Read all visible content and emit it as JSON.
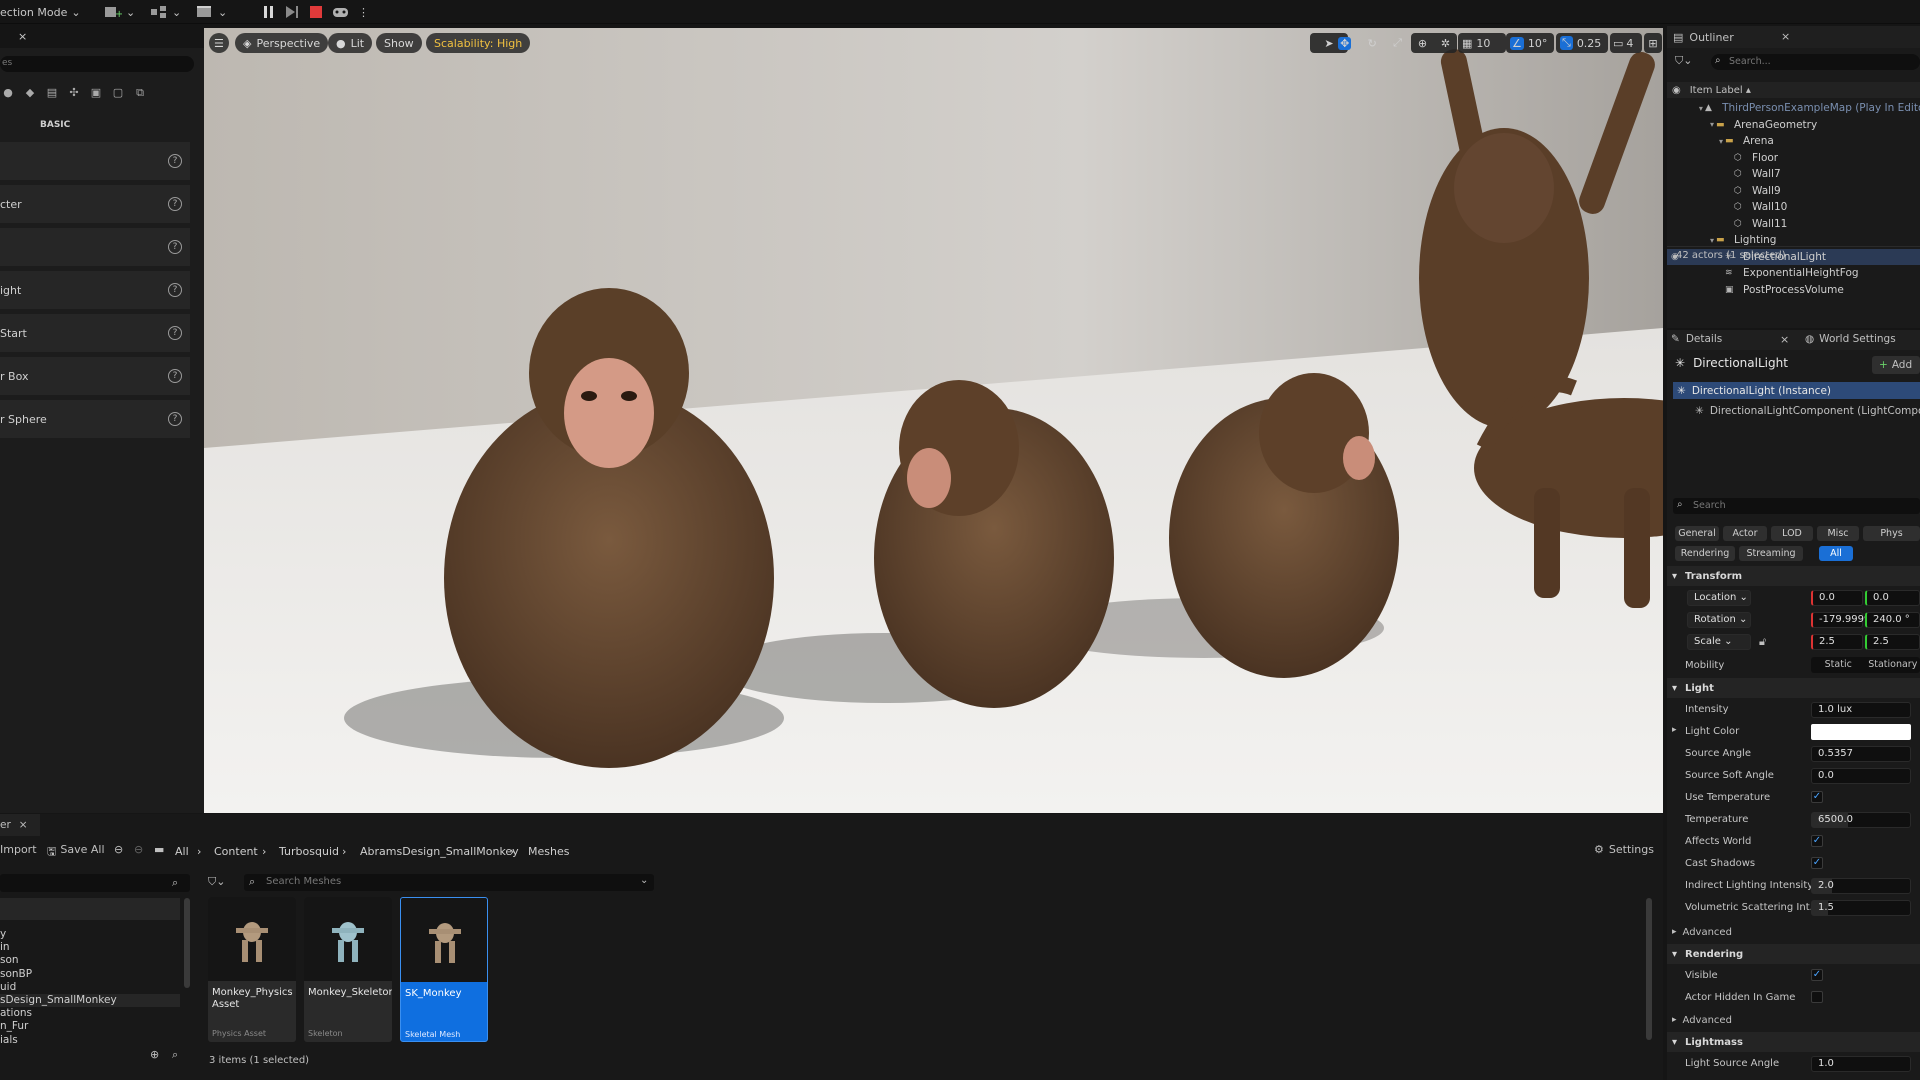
{
  "toolbar": {
    "mode_label": "ection Mode",
    "icons": [
      "add-actor-icon",
      "blueprint-icon",
      "cinematics-icon",
      "pause-icon",
      "step-icon",
      "stop-icon",
      "eject-icon",
      "more-icon"
    ]
  },
  "left_panel": {
    "tab_close": "×",
    "search_placeholder": "es",
    "basic_label": "BASIC",
    "items": [
      {
        "label": ""
      },
      {
        "label": "cter"
      },
      {
        "label": ""
      },
      {
        "label": "ight"
      },
      {
        "label": " Start"
      },
      {
        "label": "r Box"
      },
      {
        "label": "r Sphere"
      }
    ]
  },
  "viewport": {
    "menu_icon": "☰",
    "perspective_label": "Perspective",
    "lit_label": "Lit",
    "show_label": "Show",
    "scalability_label": "Scalability: High",
    "grid_value": "10",
    "angle_value": "10°",
    "scale_value": "0.25",
    "camera_value": "4"
  },
  "outliner": {
    "title": "Outliner",
    "search_placeholder": "Search...",
    "column_label": "Item Label ▴",
    "rows": [
      {
        "label": "ThirdPersonExampleMap (Play In Editor)",
        "indent": 0,
        "icon": "map-icon",
        "dim": true
      },
      {
        "label": "ArenaGeometry",
        "indent": 1,
        "icon": "folder-icon"
      },
      {
        "label": "Arena",
        "indent": 2,
        "icon": "folder-icon"
      },
      {
        "label": "Floor",
        "indent": 3,
        "icon": "mesh-icon"
      },
      {
        "label": "Wall7",
        "indent": 3,
        "icon": "mesh-icon"
      },
      {
        "label": "Wall9",
        "indent": 3,
        "icon": "mesh-icon"
      },
      {
        "label": "Wall10",
        "indent": 3,
        "icon": "mesh-icon"
      },
      {
        "label": "Wall11",
        "indent": 3,
        "icon": "mesh-icon"
      },
      {
        "label": "Lighting",
        "indent": 1,
        "icon": "folder-icon"
      },
      {
        "label": "DirectionalLight",
        "indent": 2,
        "icon": "light-icon",
        "selected": true
      },
      {
        "label": "ExponentialHeightFog",
        "indent": 2,
        "icon": "fog-icon"
      },
      {
        "label": "PostProcessVolume",
        "indent": 2,
        "icon": "volume-icon"
      }
    ],
    "status": "42 actors (1 selected)"
  },
  "details": {
    "tab_details": "Details",
    "tab_world": "World Settings",
    "actor_name": "DirectionalLight",
    "add_label": "Add",
    "instance_label": "DirectionalLight (Instance)",
    "component_label": "DirectionalLightComponent (LightComponent)",
    "search_placeholder": "Search",
    "filters_row1": [
      "General",
      "Actor",
      "LOD",
      "Misc",
      "Phys"
    ],
    "filters_row2": [
      "Rendering",
      "Streaming",
      "All"
    ],
    "transform": {
      "section": "Transform",
      "location_label": "Location",
      "location_x": "0.0",
      "location_y": "0.0",
      "rotation_label": "Rotation",
      "rotation_x": "-179.9999",
      "rotation_y": "240.0 °",
      "scale_label": "Scale",
      "scale_x": "2.5",
      "scale_y": "2.5",
      "mobility_label": "Mobility",
      "mobility_static": "Static",
      "mobility_stationary": "Stationary"
    },
    "light": {
      "section": "Light",
      "intensity_label": "Intensity",
      "intensity_value": "1.0 lux",
      "color_label": "Light Color",
      "color_value": "#ffffff",
      "source_angle_label": "Source Angle",
      "source_angle_value": "0.5357",
      "soft_angle_label": "Source Soft Angle",
      "soft_angle_value": "0.0",
      "use_temp_label": "Use Temperature",
      "temp_label": "Temperature",
      "temp_value": "6500.0",
      "affects_label": "Affects World",
      "shadows_label": "Cast Shadows",
      "indirect_label": "Indirect Lighting Intensity",
      "indirect_value": "2.0",
      "volumetric_label": "Volumetric Scattering Int...",
      "volumetric_value": "1.5",
      "advanced_label": "Advanced"
    },
    "rendering": {
      "section": "Rendering",
      "visible_label": "Visible",
      "hidden_label": "Actor Hidden In Game",
      "advanced_label": "Advanced"
    },
    "lightmass": {
      "section": "Lightmass",
      "source_angle_label": "Light Source Angle",
      "source_angle_value": "1.0"
    }
  },
  "content_browser": {
    "tab_label": "er",
    "import_label": "Import",
    "save_all_label": "Save All",
    "breadcrumbs": [
      "All",
      "Content",
      "Turbosquid",
      "AbramsDesign_SmallMonkey",
      "Meshes"
    ],
    "settings_label": "Settings",
    "search_placeholder": "Search Meshes",
    "tree": [
      "y",
      "in",
      "son",
      "sonBP",
      "uid",
      "sDesign_SmallMonkey",
      "ations",
      "n_Fur",
      "ials"
    ],
    "assets": [
      {
        "name": "Monkey_Physics Asset",
        "type": "Physics Asset",
        "selected": false
      },
      {
        "name": "Monkey_Skeleton",
        "type": "Skeleton",
        "selected": false
      },
      {
        "name": "SK_Monkey",
        "type": "Skeletal Mesh",
        "selected": true
      }
    ],
    "status": "3 items (1 selected)"
  }
}
